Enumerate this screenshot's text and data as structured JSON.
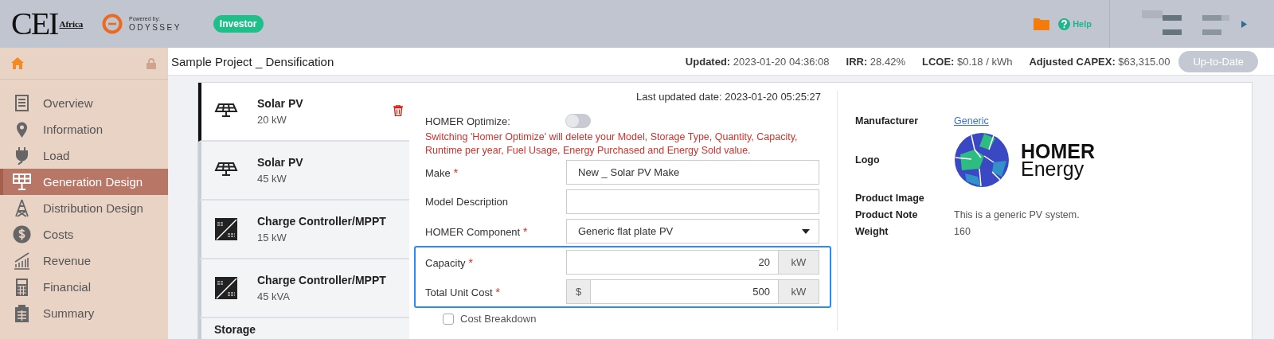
{
  "header": {
    "logo": {
      "main": "CEI",
      "sub": "Africa"
    },
    "powered_by": {
      "label": "Powered by:",
      "brand": "ODYSSEY"
    },
    "role_badge": "Investor",
    "help": "Help"
  },
  "project": {
    "title": "Sample Project _ Densification",
    "stats": [
      {
        "label": "Updated:",
        "value": "2023-01-20 04:36:08"
      },
      {
        "label": "IRR:",
        "value": "28.42%"
      },
      {
        "label": "LCOE:",
        "value": "$0.18 / kWh"
      },
      {
        "label": "Adjusted CAPEX:",
        "value": "$63,315.00"
      }
    ],
    "status_button": {
      "label": "Up-to-Date",
      "disabled": true
    }
  },
  "sidebar": {
    "items": [
      {
        "label": "Overview",
        "selected": false
      },
      {
        "label": "Information",
        "selected": false
      },
      {
        "label": "Load",
        "selected": false
      },
      {
        "label": "Generation Design",
        "selected": true
      },
      {
        "label": "Distribution Design",
        "selected": false
      },
      {
        "label": "Costs",
        "selected": false
      },
      {
        "label": "Revenue",
        "selected": false
      },
      {
        "label": "Financial",
        "selected": false
      },
      {
        "label": "Summary",
        "selected": false
      }
    ]
  },
  "components": [
    {
      "name": "Solar PV",
      "size": "20 kW",
      "kind": "solar",
      "selected": true
    },
    {
      "name": "Solar PV",
      "size": "45 kW",
      "kind": "solar",
      "selected": false
    },
    {
      "name": "Charge Controller/MPPT",
      "size": "15 kW",
      "kind": "controller",
      "selected": false
    },
    {
      "name": "Charge Controller/MPPT",
      "size": "45 kVA",
      "kind": "controller",
      "selected": false
    },
    {
      "name": "Storage",
      "kind": "storage",
      "selected": false
    }
  ],
  "form": {
    "last_updated": "Last updated date: 2023-01-20 05:25:27",
    "homer_optimize": {
      "label": "HOMER Optimize:",
      "on": false
    },
    "warning": "Switching 'Homer Optimize' will delete your Model, Storage Type, Quantity, Capacity, Runtime per year, Fuel Usage, Energy Purchased and Energy Sold value.",
    "fields": [
      {
        "label": "Make",
        "kind": "text",
        "required_mark": "*",
        "value": "New _ Solar PV Make",
        "highlighted": false
      },
      {
        "label": "Model Description",
        "kind": "text",
        "highlighted": false
      },
      {
        "label": "HOMER Component",
        "kind": "select",
        "required_mark": "*",
        "value": "Generic flat plate PV",
        "highlighted": false
      },
      {
        "label": "Capacity",
        "kind": "unit",
        "required_mark": "*",
        "value": "20",
        "unit": "kW",
        "highlighted": true
      },
      {
        "label": "Total Unit Cost",
        "kind": "unit",
        "required_mark": "*",
        "prefix": "$",
        "value": "500",
        "unit": "kW",
        "highlighted": true
      }
    ],
    "cost_breakdown": {
      "label": "Cost Breakdown",
      "checked": false
    }
  },
  "details": [
    {
      "label": "Manufacturer",
      "kind": "link",
      "value": "Generic"
    },
    {
      "label": "Logo",
      "kind": "logo",
      "value": "HOMER",
      "value2": "Energy"
    },
    {
      "label": "Product Image",
      "kind": "empty"
    },
    {
      "label": "Product Note",
      "kind": "text",
      "value": "This is a generic PV system."
    },
    {
      "label": "Weight",
      "kind": "text",
      "value": "160"
    }
  ]
}
